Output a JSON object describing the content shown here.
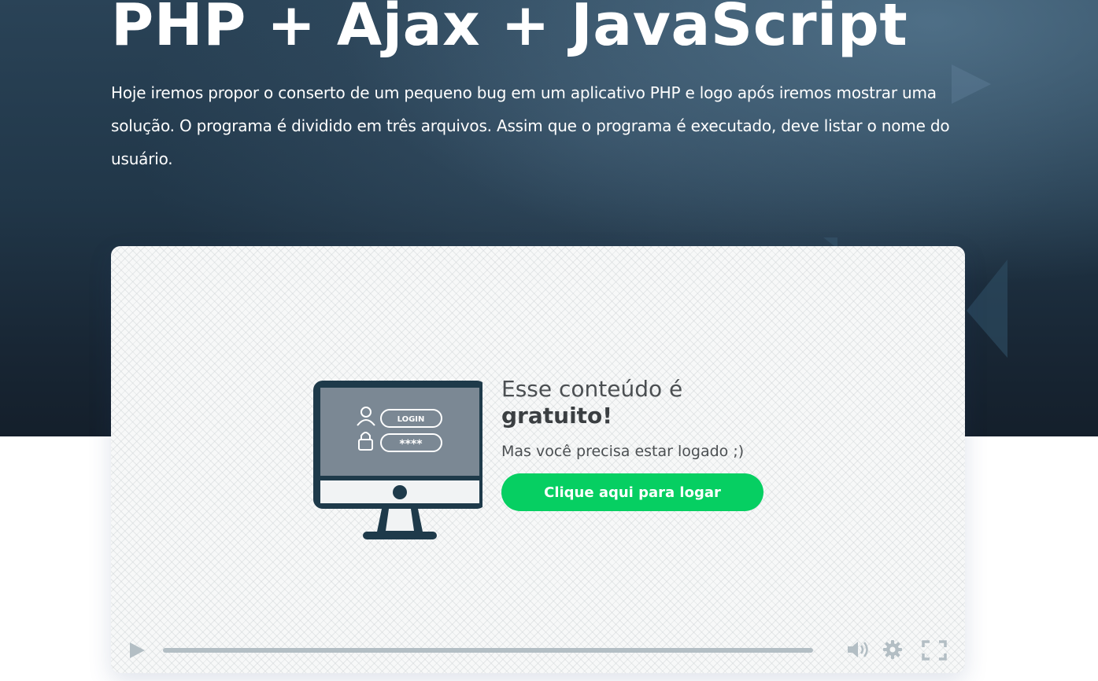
{
  "hero": {
    "title": "PHP + Ajax + JavaScript",
    "description": "Hoje iremos propor o conserto de um pequeno bug em um aplicativo PHP e logo após iremos mostrar uma solução. O programa é dividido em três arquivos. Assim que o programa é executado, deve listar o nome do usuário."
  },
  "player": {
    "gate": {
      "title_line1": "Esse conteúdo é",
      "title_line2": "gratuito!",
      "subtitle": "Mas você precisa estar logado ;)",
      "button_label": "Clique aqui para logar"
    },
    "illustration": {
      "login_label": "LOGIN",
      "password_mask": "****"
    },
    "progress": 0,
    "icons": [
      "play-icon",
      "volume-icon",
      "settings-icon",
      "fullscreen-icon"
    ]
  },
  "colors": {
    "hero_background": "#213749",
    "button": "#06cf62",
    "monitor_frame": "#1e3a4a",
    "monitor_screen": "#7b8894",
    "controls": "#b3bec4"
  }
}
